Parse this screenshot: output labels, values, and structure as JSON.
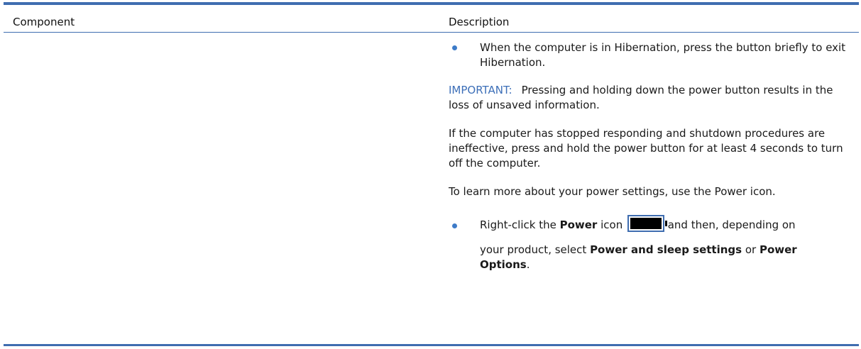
{
  "headers": {
    "component": "Component",
    "description": "Description"
  },
  "description": {
    "bullet1": "When the computer is in Hibernation, press the button briefly to exit Hibernation.",
    "important_label": "IMPORTANT:",
    "important_text": "Pressing and holding down the power button results in the loss of unsaved information.",
    "para_unresponsive": "If the computer has stopped responding and shutdown procedures are ineffective, press and hold the power button for at least 4 seconds to turn off the computer.",
    "para_power_settings": "To learn more about your power settings, use the Power icon.",
    "bullet2": {
      "prefix": "Right-click the ",
      "power_word": "Power",
      "icon_word": " icon ",
      "after_icon": " and then, depending on",
      "cont_prefix": "your product, select ",
      "option1": "Power and sleep settings",
      "or_word": " or ",
      "option2": "Power Options",
      "period": "."
    }
  },
  "colors": {
    "rule": "#3f6db0",
    "important": "#3d6fb8",
    "bullet": "#3d7bc8"
  },
  "icons": {
    "power": "battery-power-icon"
  }
}
